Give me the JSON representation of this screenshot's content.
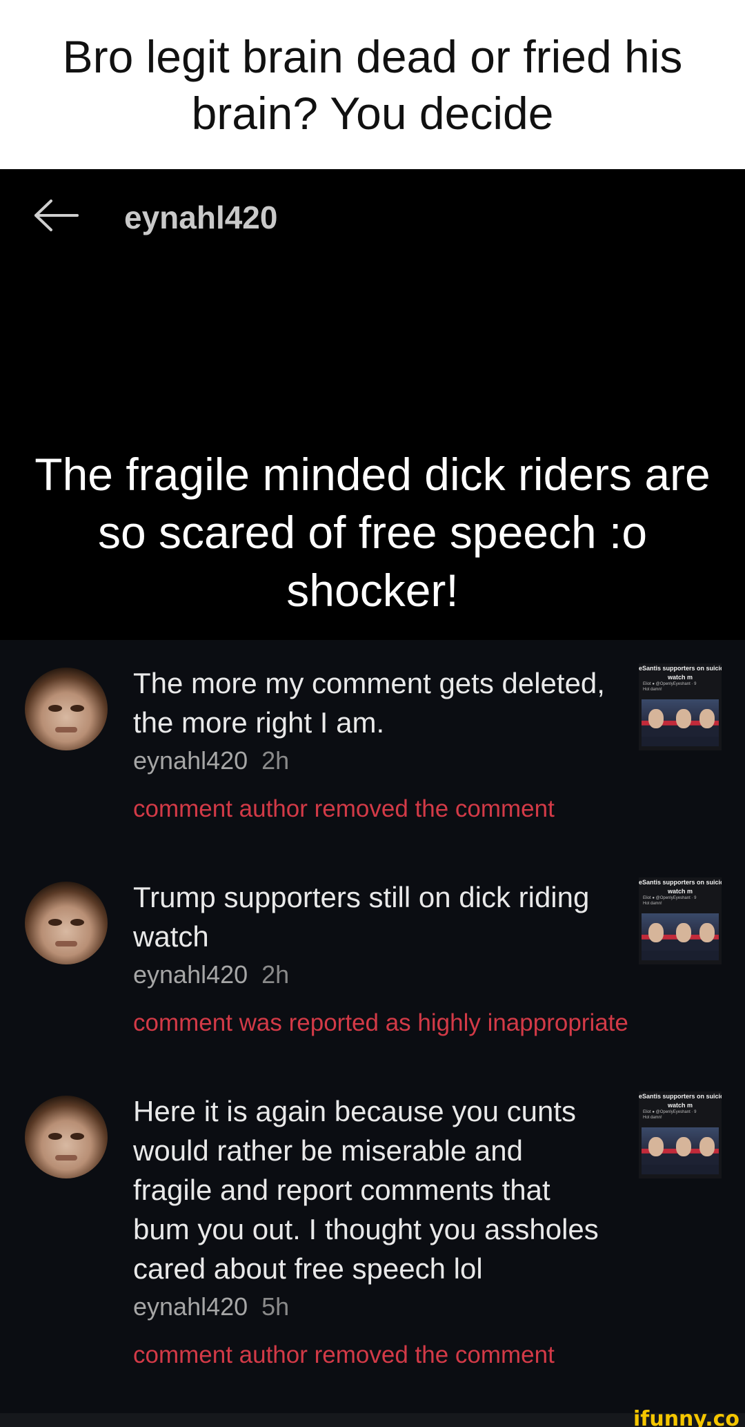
{
  "caption": "Bro legit brain dead or fried his brain? You decide",
  "header": {
    "username": "eynahl420"
  },
  "post": {
    "title": "The fragile minded dick riders are so scared of free speech :o shocker!"
  },
  "thumbnail": {
    "title_line1": "eSantis supporters on suicic",
    "title_line2": "watch m",
    "sub_line1": "Eliot ● @OpenlyEyeshant · 9",
    "sub_line2": "Hot damn!"
  },
  "comments": [
    {
      "text": "The more my comment gets deleted, the more right I am.",
      "author": "eynahl420",
      "time": "2h",
      "status": "comment author removed the comment"
    },
    {
      "text": "Trump supporters still on dick riding watch",
      "author": "eynahl420",
      "time": "2h",
      "status": "comment was reported as highly inappropriate"
    },
    {
      "text": "Here it is again because you cunts would rather be miserable and fragile and report comments that bum you out. I thought you assholes cared about free speech lol",
      "author": "eynahl420",
      "time": "5h",
      "status": "comment author removed the comment"
    }
  ],
  "watermark": "ifunny.co",
  "colors": {
    "status_red": "#d33a47",
    "comment_bg": "#0b0d12",
    "watermark_yellow": "#f5c600"
  }
}
